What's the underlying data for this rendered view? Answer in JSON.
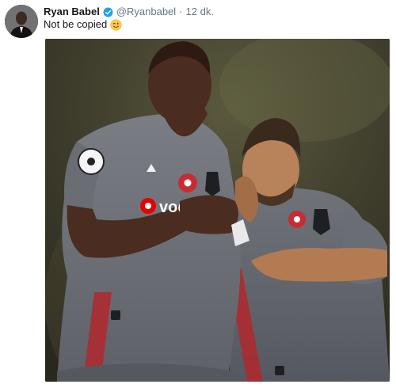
{
  "tweet": {
    "author": {
      "display_name": "Ryan Babel",
      "handle": "@Ryanbabel",
      "verified": true,
      "avatar_icon": "profile-photo"
    },
    "separator": "·",
    "timestamp": "12 dk.",
    "text": "Not be copied",
    "emoji": "winking-face-emoji",
    "media": {
      "type": "photo",
      "jersey_text": "vodafone"
    }
  },
  "colors": {
    "verified_blue": "#1da1f2",
    "text_primary": "#14171a",
    "text_secondary": "#657786",
    "jersey_grey": "#6b6e74",
    "jersey_red": "#b0282d"
  }
}
